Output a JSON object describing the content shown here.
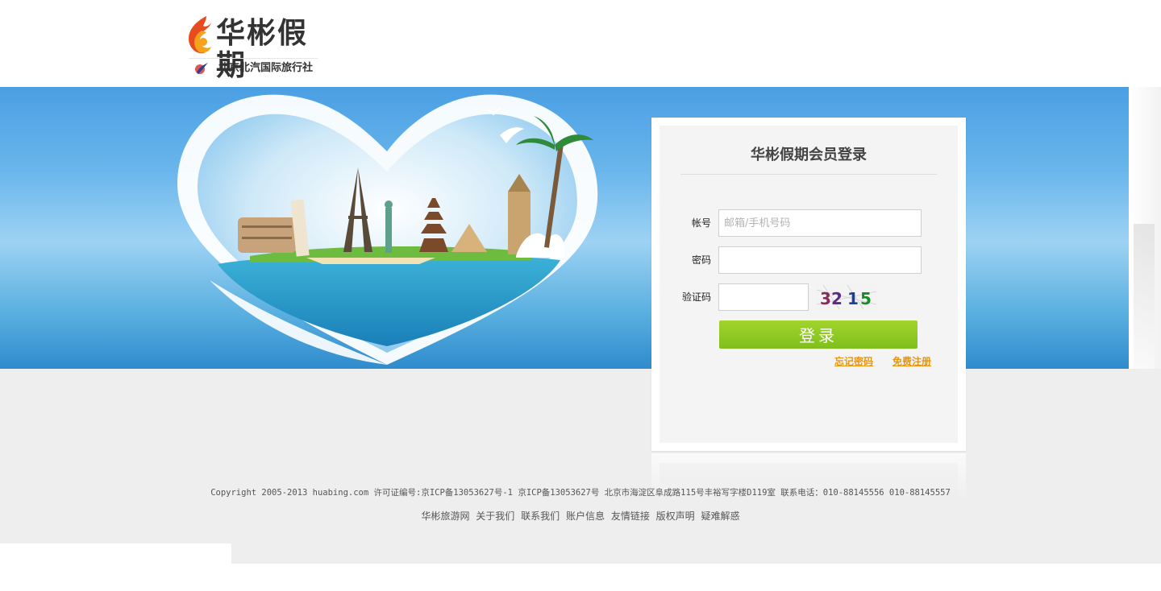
{
  "header": {
    "logo_title": "华彬假期",
    "logo_subtitle": "北京北汽国际旅行社"
  },
  "login": {
    "title": "华彬假期会员登录",
    "account_label": "帐号",
    "account_placeholder": "邮箱/手机号码",
    "account_value": "",
    "password_label": "密码",
    "password_value": "",
    "captcha_label": "验证码",
    "captcha_value": "",
    "captcha_text": "3215",
    "submit_label": "登录",
    "forgot_label": "忘记密码",
    "register_label": "免费注册"
  },
  "footer": {
    "copyright": "Copyright 2005-2013 huabing.com 许可证编号:京ICP备13053627号-1 京ICP备13053627号 北京市海淀区阜成路115号丰裕写字楼D119室 联系电话：010-88145556 010-88145557",
    "links": [
      "华彬旅游网",
      "关于我们",
      "联系我们",
      "账户信息",
      "友情链接",
      "版权声明",
      "疑难解惑"
    ]
  },
  "colors": {
    "accent_green": "#8cc524",
    "link_orange": "#e8950c",
    "banner_blue": "#4a9fe3"
  }
}
